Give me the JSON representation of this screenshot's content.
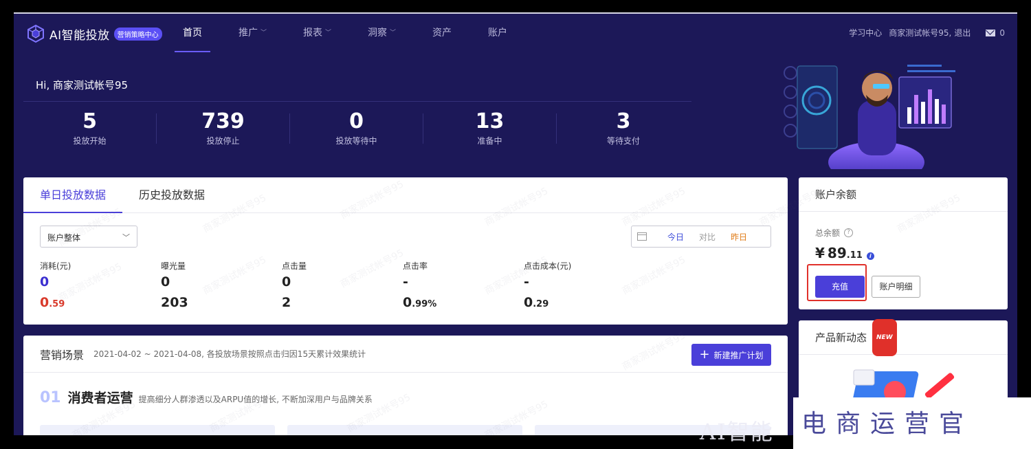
{
  "header": {
    "logo_text": "AI智能投放",
    "logo_badge": "营销策略中心",
    "nav": [
      {
        "label": "首页",
        "active": true,
        "dropdown": false
      },
      {
        "label": "推广",
        "active": false,
        "dropdown": true
      },
      {
        "label": "报表",
        "active": false,
        "dropdown": true
      },
      {
        "label": "洞察",
        "active": false,
        "dropdown": true
      },
      {
        "label": "资产",
        "active": false,
        "dropdown": false
      },
      {
        "label": "账户",
        "active": false,
        "dropdown": false
      }
    ],
    "learning_center": "学习中心",
    "account_name": "商家测试帐号95,",
    "logout": "退出",
    "mail_count": "0"
  },
  "greeting": "Hi, 商家测试帐号95",
  "stats": [
    {
      "value": "5",
      "label": "投放开始"
    },
    {
      "value": "739",
      "label": "投放停止"
    },
    {
      "value": "0",
      "label": "投放等待中"
    },
    {
      "value": "13",
      "label": "准备中"
    },
    {
      "value": "3",
      "label": "等待支付"
    }
  ],
  "data_card": {
    "tabs": [
      {
        "label": "单日投放数据",
        "active": true
      },
      {
        "label": "历史投放数据",
        "active": false
      }
    ],
    "scope_select": "账户整体",
    "date_options": {
      "today": "今日",
      "compare": "对比",
      "yesterday": "昨日"
    },
    "metrics": [
      {
        "label": "消耗(元)",
        "today_int": "0",
        "today_dec": "",
        "yesterday_int": "0",
        "yesterday_dec": ".59"
      },
      {
        "label": "曝光量",
        "today_int": "0",
        "today_dec": "",
        "yesterday_int": "203",
        "yesterday_dec": ""
      },
      {
        "label": "点击量",
        "today_int": "0",
        "today_dec": "",
        "yesterday_int": "2",
        "yesterday_dec": ""
      },
      {
        "label": "点击率",
        "today_int": "-",
        "today_dec": "",
        "yesterday_int": "0",
        "yesterday_dec": ".99%"
      },
      {
        "label": "点击成本(元)",
        "today_int": "-",
        "today_dec": "",
        "yesterday_int": "0",
        "yesterday_dec": ".29"
      }
    ]
  },
  "scene_card": {
    "title": "营销场景",
    "subtitle": "2021-04-02 ~ 2021-04-08, 各投放场景按照点击归因15天累计效果统计",
    "new_plan_button": "新建推广计划",
    "section_number": "01",
    "section_title": "消费者运营",
    "section_desc": "提高细分人群渗透以及ARPU值的增长, 不断加深用户与品牌关系"
  },
  "balance_card": {
    "title": "账户余额",
    "total_label": "总余额",
    "currency": "¥",
    "amount_int": "89",
    "amount_dec": ".11",
    "recharge_button": "充值",
    "detail_button": "账户明细"
  },
  "news_card": {
    "title": "产品新动态",
    "badge": "NEW"
  },
  "watermark_text": "商家测试帐号95",
  "overlay_caption": "AI智能",
  "overlay_brand": "电商运营官",
  "colors": {
    "header_bg": "#1c1858",
    "accent": "#4a3fd9",
    "highlight_red": "#e0302a",
    "yesterday_red": "#d93a2b",
    "yesterday_orange": "#e07b16"
  }
}
